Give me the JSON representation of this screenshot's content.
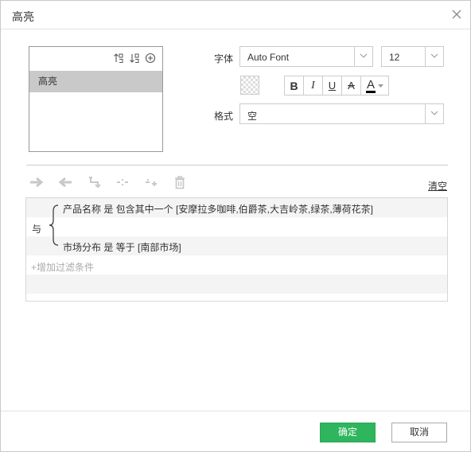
{
  "dialog": {
    "title": "高亮",
    "icons": {
      "close": "close-icon"
    }
  },
  "highlight_list": {
    "toolbar_icons": [
      "sort-ascending-icon",
      "sort-descending-icon",
      "add-circle-icon"
    ],
    "items": [
      {
        "label": "高亮",
        "selected": true
      }
    ]
  },
  "font_settings": {
    "font_label": "字体",
    "font_value": "Auto Font",
    "size_value": "12",
    "format_label": "格式",
    "format_value": "空",
    "style_buttons": [
      "B",
      "I",
      "U",
      "A"
    ],
    "font_color_letter": "A",
    "font_color": "#000000"
  },
  "filter_toolbar": {
    "icons": [
      "arrow-right-icon",
      "arrow-left-icon",
      "indent-up-icon",
      "remove-condition-icon",
      "add-condition-icon",
      "trash-icon"
    ],
    "clear_label": "清空"
  },
  "filter_conditions": {
    "conjunction": "与",
    "conditions": [
      "产品名称 是 包含其中一个 [安摩拉多咖啡,伯爵茶,大吉岭茶,绿茶,薄荷花茶]",
      "市场分布 是 等于 [南部市场]"
    ],
    "add_label": "+增加过滤条件"
  },
  "footer": {
    "ok_label": "确定",
    "cancel_label": "取消",
    "ok_color": "#2fb55d"
  }
}
